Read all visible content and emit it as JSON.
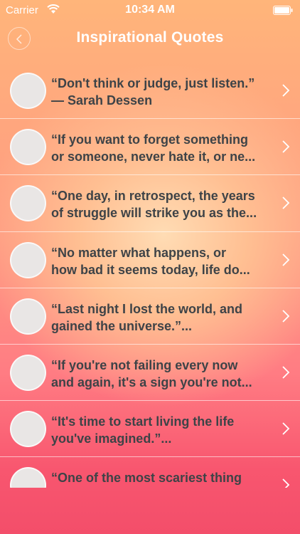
{
  "status_bar": {
    "carrier": "Carrier",
    "time": "10:34 AM"
  },
  "nav": {
    "title": "Inspirational Quotes",
    "back_icon": "chevron-left-icon"
  },
  "quotes": [
    {
      "text": "“Don't think or judge, just listen.”\n— Sarah Dessen"
    },
    {
      "text": "“If you want to forget something\nor someone, never hate it, or ne..."
    },
    {
      "text": "“One day, in retrospect, the years\nof struggle will strike you as the..."
    },
    {
      "text": "“No matter what happens, or\nhow bad it seems today, life do..."
    },
    {
      "text": "“Last night I lost the world, and\ngained the universe.”..."
    },
    {
      "text": "“If you're not failing every now\nand again, it's a sign you're not..."
    },
    {
      "text": "“It's time to start living the life\nyou've imagined.”..."
    },
    {
      "text": "“One of the most scariest thing"
    }
  ],
  "colors": {
    "text_dark": "#3e4347",
    "white": "#ffffff"
  }
}
